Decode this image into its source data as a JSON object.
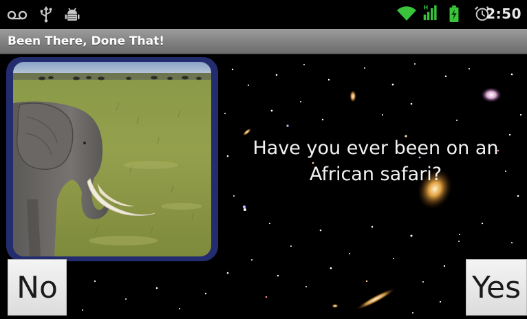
{
  "status_bar": {
    "time": "2:50",
    "icons": [
      "voicemail-icon",
      "usb-icon",
      "android-debug-icon",
      "wifi-icon",
      "signal-icon",
      "battery-charging-icon",
      "alarm-icon"
    ],
    "colors": {
      "wifi": "#39c43c",
      "signal": "#39c43c",
      "battery": "#39c43c",
      "icon_gray": "#c8c8c8"
    }
  },
  "app": {
    "title": "Been There, Done That!"
  },
  "main": {
    "question": "Have you ever been on an African safari?",
    "image": "elephant-safari-photo",
    "image_frame_color": "#232c6e"
  },
  "buttons": {
    "no_label": "No",
    "yes_label": "Yes"
  }
}
